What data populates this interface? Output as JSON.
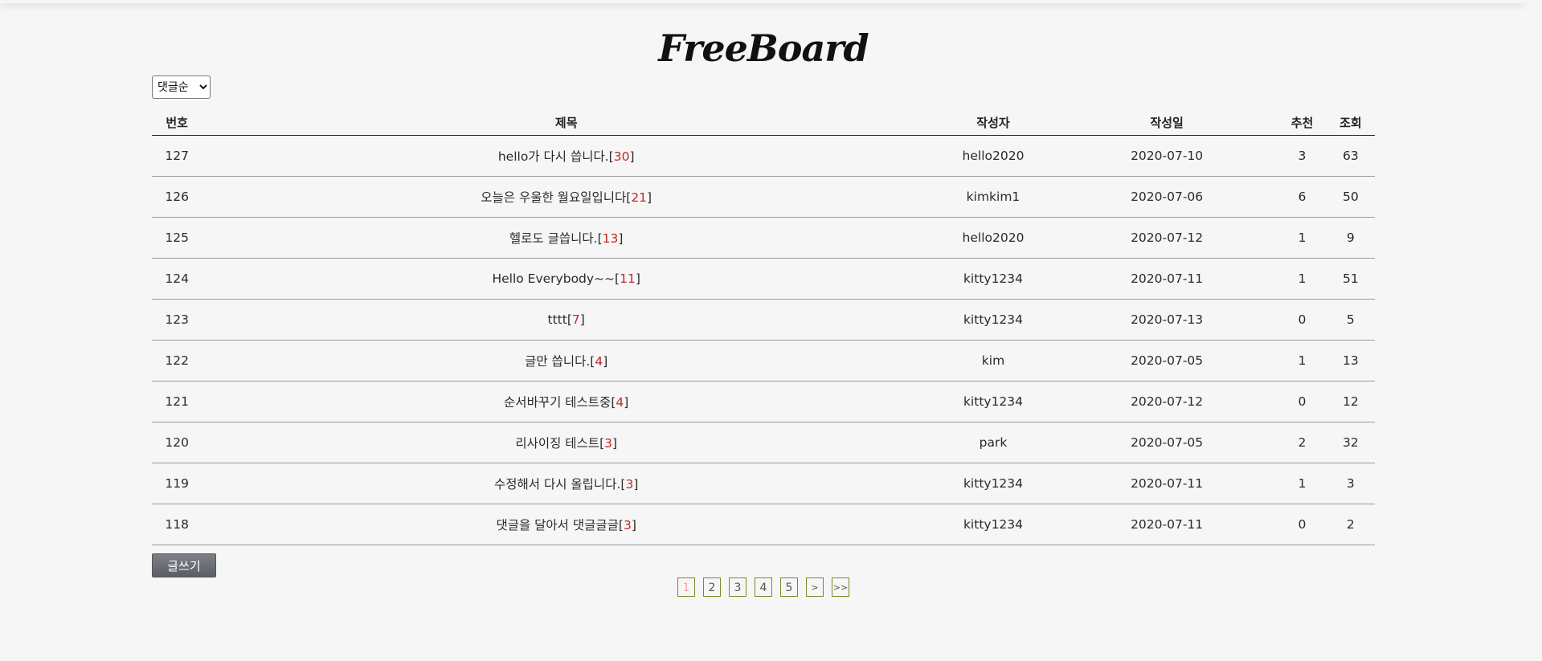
{
  "header": {
    "title": "FreeBoard"
  },
  "sort": {
    "selected": "댓글순"
  },
  "table": {
    "headers": {
      "num": "번호",
      "title": "제목",
      "writer": "작성자",
      "date": "작성일",
      "recommend": "추천",
      "views": "조회"
    },
    "rows": [
      {
        "num": "127",
        "title": "hello가 다시 씁니다.",
        "comments": "30",
        "writer": "hello2020",
        "date": "2020-07-10",
        "recommend": "3",
        "views": "63"
      },
      {
        "num": "126",
        "title": "오늘은 우울한 월요일입니다",
        "comments": "21",
        "writer": "kimkim1",
        "date": "2020-07-06",
        "recommend": "6",
        "views": "50"
      },
      {
        "num": "125",
        "title": "헬로도 글씁니다.",
        "comments": "13",
        "writer": "hello2020",
        "date": "2020-07-12",
        "recommend": "1",
        "views": "9"
      },
      {
        "num": "124",
        "title": "Hello Everybody~~",
        "comments": "11",
        "writer": "kitty1234",
        "date": "2020-07-11",
        "recommend": "1",
        "views": "51"
      },
      {
        "num": "123",
        "title": "tttt",
        "comments": "7",
        "writer": "kitty1234",
        "date": "2020-07-13",
        "recommend": "0",
        "views": "5"
      },
      {
        "num": "122",
        "title": "글만 씁니다.",
        "comments": "4",
        "writer": "kim",
        "date": "2020-07-05",
        "recommend": "1",
        "views": "13"
      },
      {
        "num": "121",
        "title": "순서바꾸기 테스트중",
        "comments": "4",
        "writer": "kitty1234",
        "date": "2020-07-12",
        "recommend": "0",
        "views": "12"
      },
      {
        "num": "120",
        "title": "리사이징 테스트",
        "comments": "3",
        "writer": "park",
        "date": "2020-07-05",
        "recommend": "2",
        "views": "32"
      },
      {
        "num": "119",
        "title": "수정해서 다시 올립니다.",
        "comments": "3",
        "writer": "kitty1234",
        "date": "2020-07-11",
        "recommend": "1",
        "views": "3"
      },
      {
        "num": "118",
        "title": "댓글을 달아서 댓글글글",
        "comments": "3",
        "writer": "kitty1234",
        "date": "2020-07-11",
        "recommend": "0",
        "views": "2"
      }
    ]
  },
  "write_button": {
    "label": "글쓰기"
  },
  "pagination": {
    "pages": [
      "1",
      "2",
      "3",
      "4",
      "5"
    ],
    "current": "1",
    "next": ">",
    "last": ">>"
  },
  "colors": {
    "comment_count": "#c0282a",
    "active_page": "#f0a0aa",
    "page_border": "#7a8a2a"
  }
}
